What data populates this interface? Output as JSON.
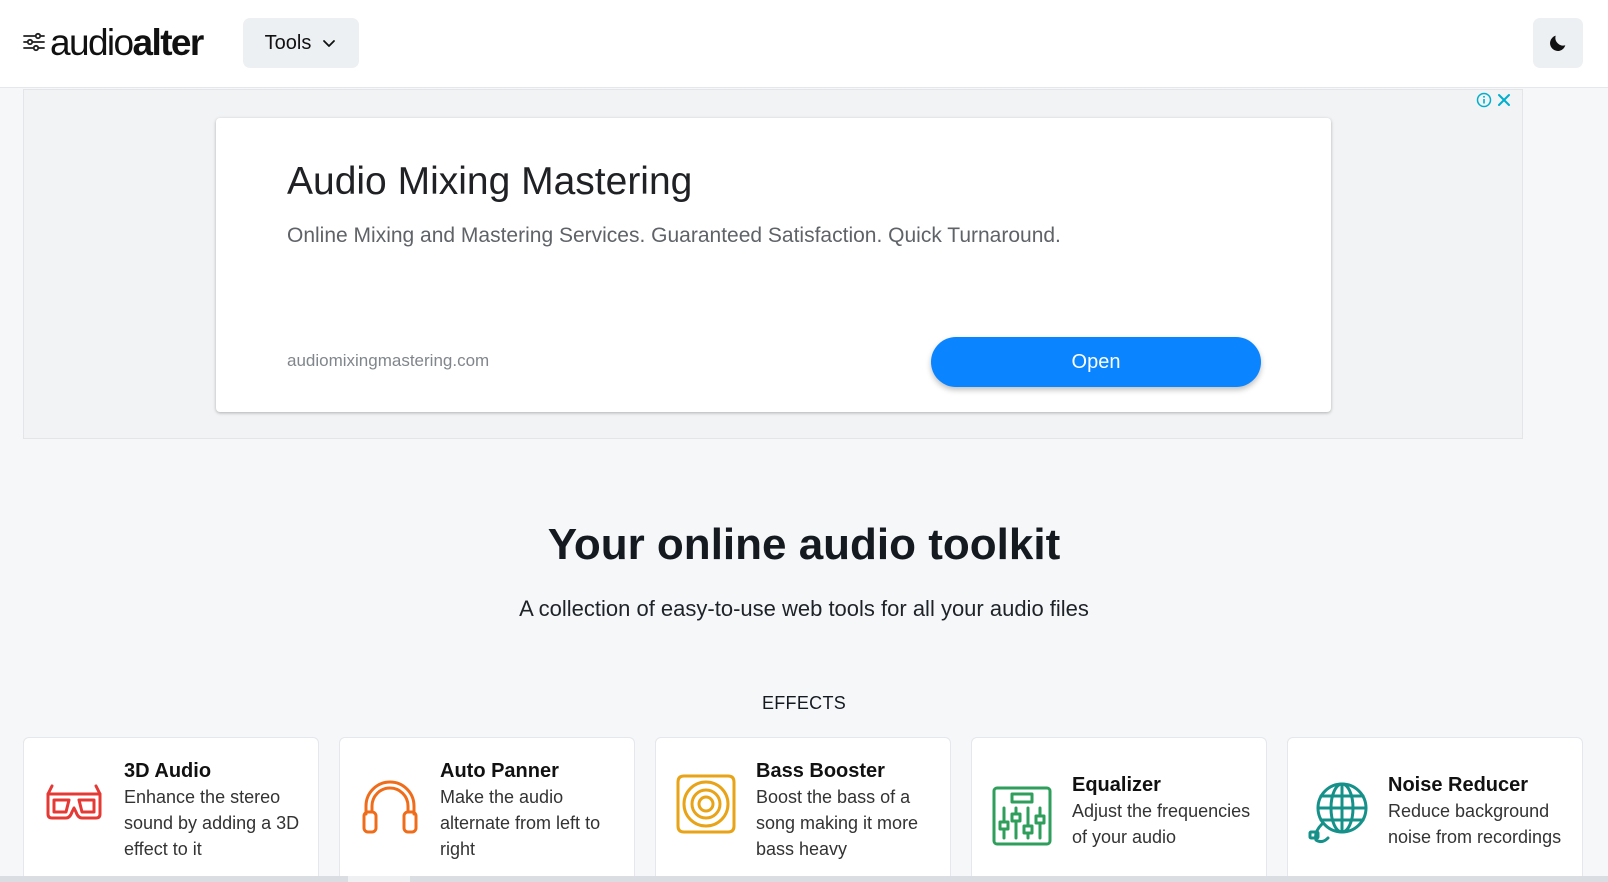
{
  "header": {
    "logo_light": "audio",
    "logo_bold": "alter",
    "tools_label": "Tools"
  },
  "ad": {
    "title": "Audio Mixing Mastering",
    "description": "Online Mixing and Mastering Services. Guaranteed Satisfaction. Quick Turnaround.",
    "url": "audiomixingmastering.com",
    "button_label": "Open"
  },
  "hero": {
    "title": "Your online audio toolkit",
    "subtitle": "A collection of easy-to-use web tools for all your audio files"
  },
  "section": {
    "label": "EFFECTS"
  },
  "tools": [
    {
      "title": "3D Audio",
      "description": "Enhance the stereo sound by adding a 3D effect to it",
      "icon": "3d-glasses-icon",
      "color": "#e53935"
    },
    {
      "title": "Auto Panner",
      "description": "Make the audio alternate from left to right",
      "icon": "headphones-icon",
      "color": "#ef6c1a"
    },
    {
      "title": "Bass Booster",
      "description": "Boost the bass of a song making it more bass heavy",
      "icon": "speaker-icon",
      "color": "#e8a317"
    },
    {
      "title": "Equalizer",
      "description": "Adjust the frequencies of your audio",
      "icon": "equalizer-icon",
      "color": "#2e9e5b"
    },
    {
      "title": "Noise Reducer",
      "description": "Reduce background noise from recordings",
      "icon": "globe-plug-icon",
      "color": "#15918a"
    }
  ],
  "colors": {
    "accent": "#0a84ff",
    "background": "#f5f7f9"
  }
}
